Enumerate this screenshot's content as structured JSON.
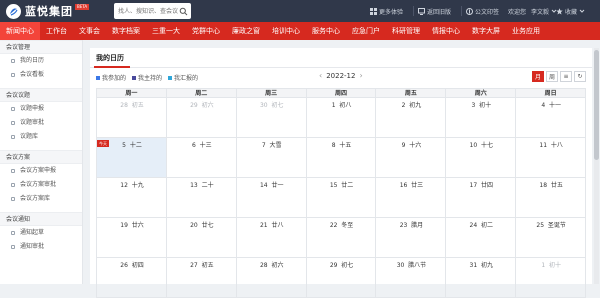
{
  "app": {
    "logo_text": "蓝悦集团",
    "logo_badge": "BETA"
  },
  "search": {
    "placeholder": "找人、搜知识、查会议"
  },
  "topbar": {
    "more_systems": "更多体验",
    "notice": "返回旧版",
    "official_docs": "公文印签",
    "welcome": "欢迎您",
    "user_name": "李文毅",
    "favorites": "收藏"
  },
  "nav": {
    "items": [
      {
        "label": "新闻中心",
        "active": true
      },
      {
        "label": "工作台",
        "active": false
      },
      {
        "label": "文事会",
        "active": false
      },
      {
        "label": "数字档案",
        "active": false
      },
      {
        "label": "三重一大",
        "active": false
      },
      {
        "label": "党群中心",
        "active": false
      },
      {
        "label": "廉政之窗",
        "active": false
      },
      {
        "label": "培训中心",
        "active": false
      },
      {
        "label": "服务中心",
        "active": false
      },
      {
        "label": "应急门户",
        "active": false
      },
      {
        "label": "科研管理",
        "active": false
      },
      {
        "label": "情报中心",
        "active": false
      },
      {
        "label": "数字大屏",
        "active": false
      },
      {
        "label": "业务应用",
        "active": false
      }
    ]
  },
  "sidebar": {
    "sections": [
      {
        "title": "会议管理",
        "items": [
          "我的日历",
          "会议看板"
        ]
      },
      {
        "title": "会议议题",
        "items": [
          "议题申报",
          "议题审批",
          "议题库"
        ]
      },
      {
        "title": "会议方案",
        "items": [
          "会议方案申报",
          "会议方案审批",
          "会议方案库"
        ]
      },
      {
        "title": "会议通知",
        "items": [
          "通知起草",
          "通知审批"
        ]
      }
    ]
  },
  "main": {
    "title": "我的日历",
    "legend": [
      {
        "label": "我参加的",
        "color": "#3b78e7"
      },
      {
        "label": "我主持的",
        "color": "#4a4a9c"
      },
      {
        "label": "我汇报的",
        "color": "#2fa6d9"
      }
    ],
    "month": "2022-12",
    "prev": "‹",
    "next": "›",
    "views": [
      "月",
      "周",
      "≡",
      "↻"
    ],
    "today_tag": "今天"
  },
  "calendar": {
    "weekdays": [
      "周一",
      "周二",
      "周三",
      "周四",
      "周五",
      "周六",
      "周日"
    ],
    "weeks": [
      [
        {
          "d": "28",
          "l": "初五",
          "other": true
        },
        {
          "d": "29",
          "l": "初六",
          "other": true
        },
        {
          "d": "30",
          "l": "初七",
          "other": true
        },
        {
          "d": "1",
          "l": "初八",
          "other": false
        },
        {
          "d": "2",
          "l": "初九",
          "other": false
        },
        {
          "d": "3",
          "l": "初十",
          "other": false
        },
        {
          "d": "4",
          "l": "十一",
          "other": false
        }
      ],
      [
        {
          "d": "5",
          "l": "十二",
          "other": false,
          "today": true
        },
        {
          "d": "6",
          "l": "十三",
          "other": false
        },
        {
          "d": "7",
          "l": "大雪",
          "other": false
        },
        {
          "d": "8",
          "l": "十五",
          "other": false
        },
        {
          "d": "9",
          "l": "十六",
          "other": false
        },
        {
          "d": "10",
          "l": "十七",
          "other": false
        },
        {
          "d": "11",
          "l": "十八",
          "other": false
        }
      ],
      [
        {
          "d": "12",
          "l": "十九",
          "other": false
        },
        {
          "d": "13",
          "l": "二十",
          "other": false
        },
        {
          "d": "14",
          "l": "廿一",
          "other": false
        },
        {
          "d": "15",
          "l": "廿二",
          "other": false
        },
        {
          "d": "16",
          "l": "廿三",
          "other": false
        },
        {
          "d": "17",
          "l": "廿四",
          "other": false
        },
        {
          "d": "18",
          "l": "廿五",
          "other": false
        }
      ],
      [
        {
          "d": "19",
          "l": "廿六",
          "other": false
        },
        {
          "d": "20",
          "l": "廿七",
          "other": false
        },
        {
          "d": "21",
          "l": "廿八",
          "other": false
        },
        {
          "d": "22",
          "l": "冬至",
          "other": false
        },
        {
          "d": "23",
          "l": "腊月",
          "other": false
        },
        {
          "d": "24",
          "l": "初二",
          "other": false
        },
        {
          "d": "25",
          "l": "圣诞节",
          "other": false
        }
      ],
      [
        {
          "d": "26",
          "l": "初四",
          "other": false
        },
        {
          "d": "27",
          "l": "初五",
          "other": false
        },
        {
          "d": "28",
          "l": "初六",
          "other": false
        },
        {
          "d": "29",
          "l": "初七",
          "other": false
        },
        {
          "d": "30",
          "l": "腊八节",
          "other": false
        },
        {
          "d": "31",
          "l": "初九",
          "other": false
        },
        {
          "d": "1",
          "l": "初十",
          "other": true
        }
      ]
    ]
  },
  "colors": {
    "brand_red": "#d6291f",
    "topbar": "#30384a",
    "today_bg": "#e5eef8"
  }
}
